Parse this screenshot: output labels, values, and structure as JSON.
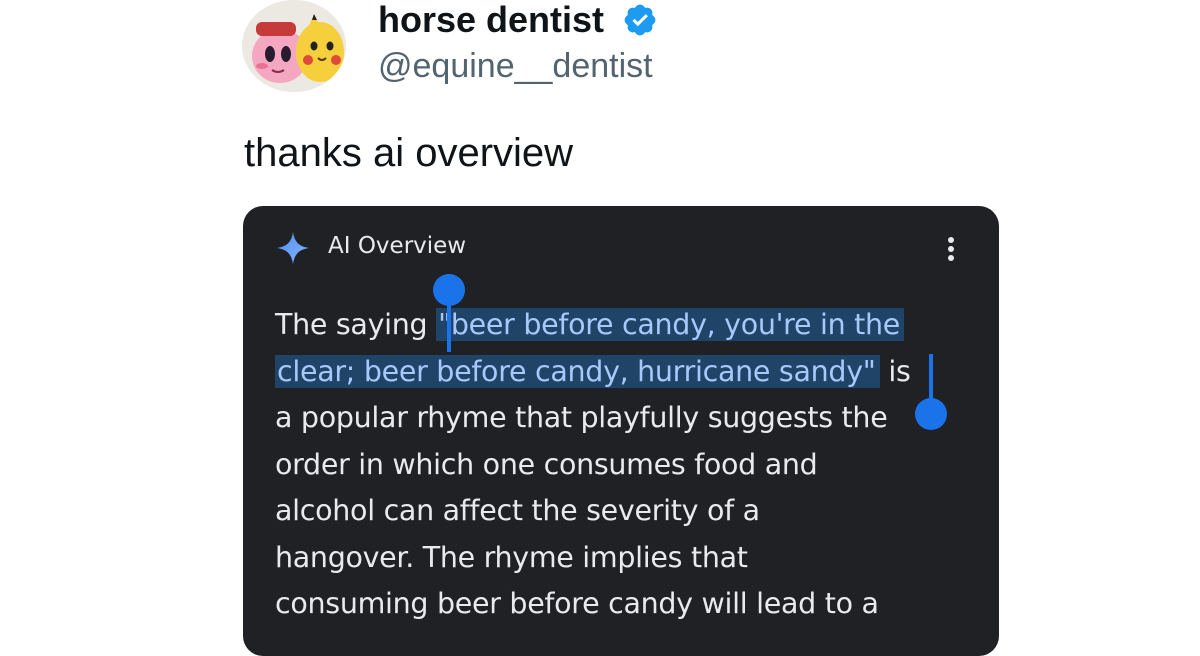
{
  "author": {
    "display_name": "horse dentist",
    "handle": "@equine__dentist",
    "verified": true,
    "avatar_icon": "avatar-cartoon-characters"
  },
  "tweet": {
    "text": "thanks ai overview"
  },
  "ai_overview": {
    "title": "AI Overview",
    "icon": "sparkle-icon",
    "menu_icon": "more-vert-icon",
    "body": {
      "line1_pre": "The saying ",
      "line1_hl": "\"beer before candy, you're in the",
      "line2_hl": "clear; beer before candy, hurricane sandy\"",
      "line2_post": " is",
      "line3": "a popular rhyme that playfully suggests the",
      "line4": "order in which one consumes food and",
      "line5": "alcohol can affect the severity of a",
      "line6": "hangover. The rhyme implies that",
      "line7": "consuming beer before candy will lead to a"
    },
    "colors": {
      "card_bg": "#202124",
      "text": "#e8eaed",
      "highlight_bg": "#1f4468",
      "highlight_text": "#a8c7fa",
      "selection_handle": "#1a73e8"
    }
  },
  "colors": {
    "verified_badge": "#1d9bf0",
    "handle_text": "#536471"
  }
}
